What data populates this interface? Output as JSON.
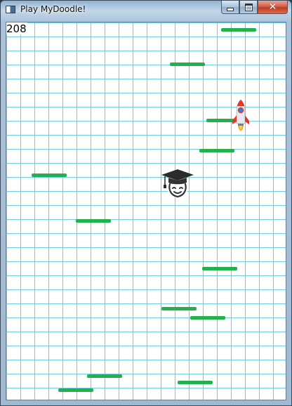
{
  "window": {
    "title": "Play MyDoodle!",
    "app_icon": "window-app-icon",
    "caption_buttons": {
      "minimize_icon": "minimize-icon",
      "maximize_icon": "maximize-icon",
      "close_icon": "close-icon",
      "close_glyph": "✕"
    }
  },
  "game": {
    "score": "208",
    "grid_color": "#6fcfe0",
    "background_color": "#ffffff",
    "platform_color": "#22b14c",
    "player_icon": "doodler-graduate-icon",
    "powerup_icon": "rocket-icon",
    "platforms_count_visible": 13
  }
}
